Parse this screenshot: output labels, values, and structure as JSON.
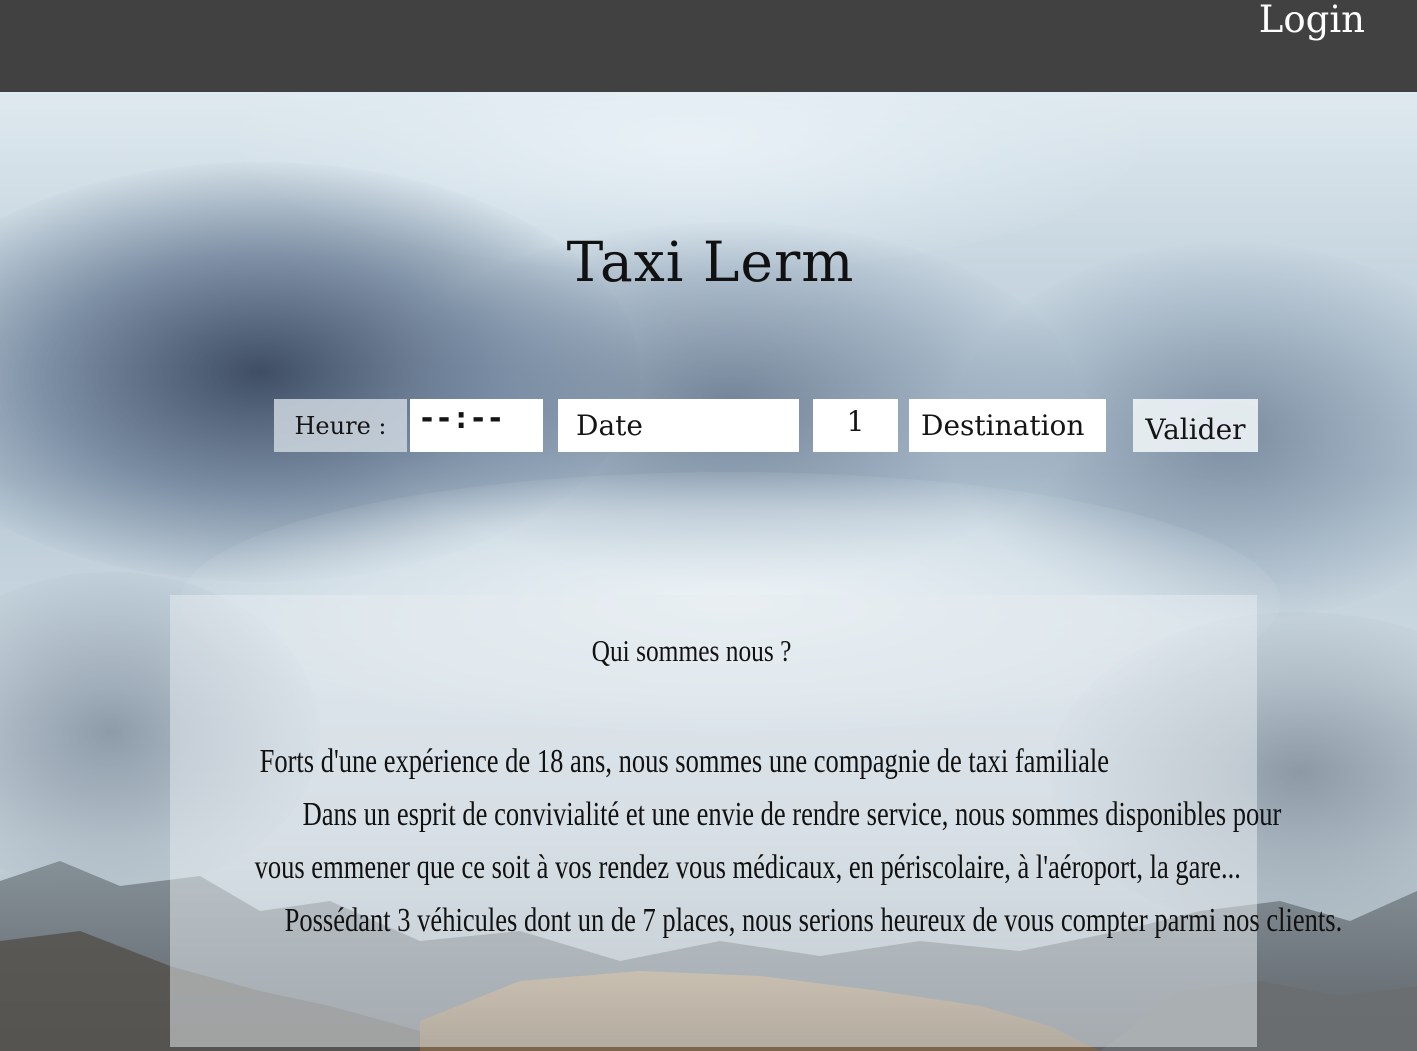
{
  "header": {
    "login_label": "Login"
  },
  "hero": {
    "title": "Taxi Lerm"
  },
  "booking": {
    "heure_label": "Heure :",
    "time_value": "--:--",
    "date_placeholder": "Date",
    "quantity_value": "1",
    "destination_placeholder": "Destination",
    "submit_label": "Valider"
  },
  "about": {
    "title": "Qui sommes nous ?",
    "lines": [
      "Forts d'une expérience de 18 ans, nous sommes une compagnie de taxi familiale",
      "Dans un esprit de convivialité et une envie de rendre service, nous sommes disponibles pour",
      "vous emmener que ce soit à vos  rendez vous médicaux, en périscolaire, à l'aéroport, la gare...",
      "Possédant 3 véhicules dont un de 7 places, nous serions heureux de vous compter parmi nos clients."
    ]
  },
  "colors": {
    "topbar": "#414141",
    "text": "#111111",
    "input_bg": "#ffffff"
  }
}
